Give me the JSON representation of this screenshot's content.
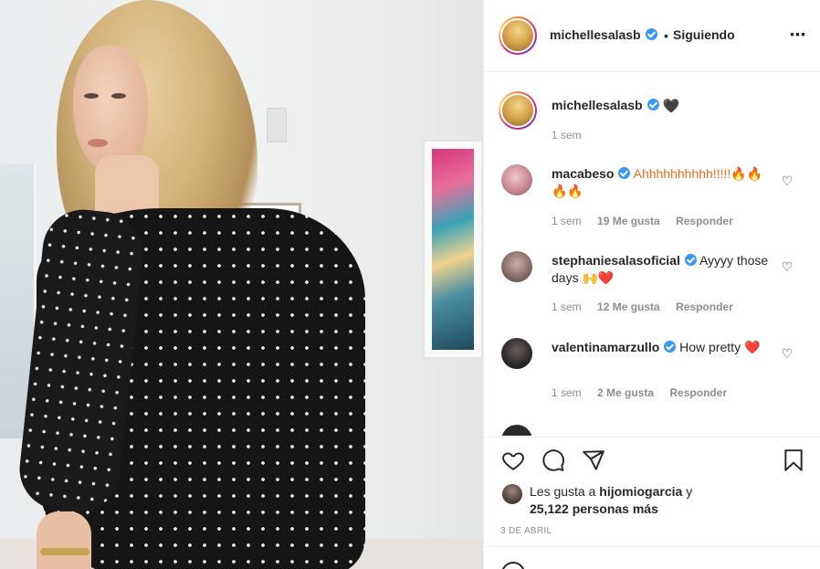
{
  "header": {
    "username": "michellesalasb",
    "separator": "•",
    "follow_status": "Siguiendo",
    "more_icon": "⋯"
  },
  "caption": {
    "username": "michellesalasb",
    "text": "🖤",
    "time": "1 sem"
  },
  "comments": [
    {
      "username": "macabeso",
      "verified": true,
      "text": "Ahhhhhhhhhh!!!!!🔥🔥🔥🔥",
      "time": "1 sem",
      "likes": "19 Me gusta",
      "reply": "Responder",
      "avatar_color": "#c98791"
    },
    {
      "username": "stephaniesalasoficial",
      "verified": true,
      "text": "Ayyyy those days 🙌❤️",
      "time": "1 sem",
      "likes": "12 Me gusta",
      "reply": "Responder",
      "avatar_color": "#8a6f6a"
    },
    {
      "username": "valentinamarzullo",
      "verified": true,
      "text": "How pretty ❤️",
      "time": "1 sem",
      "likes": "2 Me gusta",
      "reply": "Responder",
      "avatar_color": "#2c2928"
    }
  ],
  "actions": {
    "like_icon": "heart-outline-icon",
    "comment_icon": "comment-icon",
    "share_icon": "paper-plane-icon",
    "save_icon": "bookmark-icon"
  },
  "liked_by": {
    "prefix": "Les gusta a",
    "user": "hijomiogarcia",
    "conj": "y",
    "others": "25,122 personas más"
  },
  "date": "3 DE ABRIL",
  "colors": {
    "text": "#262626",
    "muted": "#8e8e8e",
    "verified": "#3897f0",
    "border": "#efefef"
  }
}
